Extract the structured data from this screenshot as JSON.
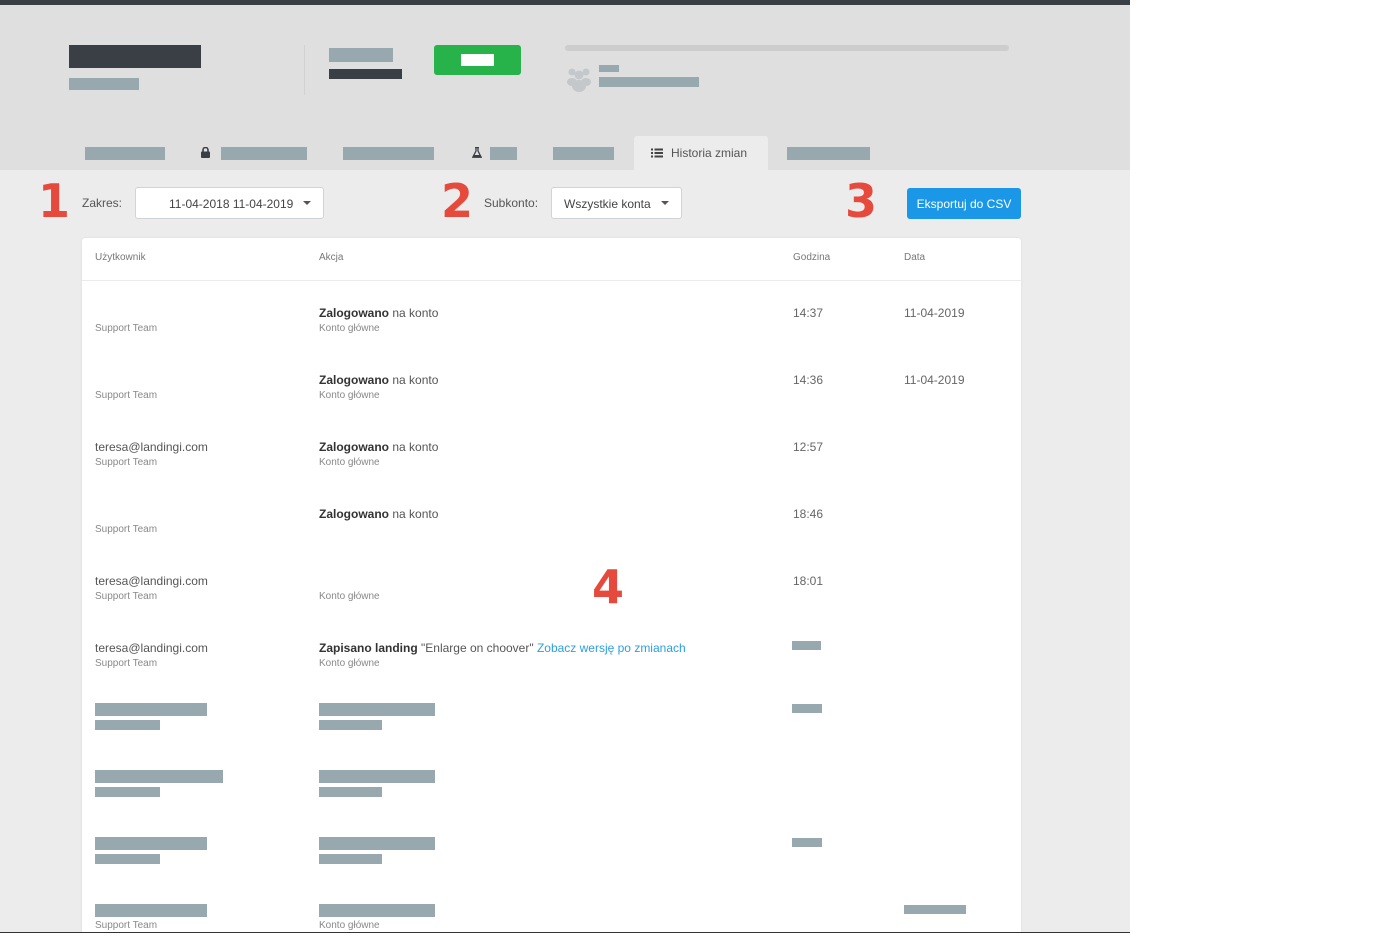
{
  "tabs": {
    "active_label": "Historia zmian"
  },
  "filters": {
    "range_label": "Zakres:",
    "range_value": "11-04-2018 11-04-2019",
    "subaccount_label": "Subkonto:",
    "subaccount_value": "Wszystkie konta",
    "export_label": "Eksportuj do CSV"
  },
  "annotations": [
    "1",
    "2",
    "3",
    "4"
  ],
  "table": {
    "headers": [
      "Użytkownik",
      "Akcja",
      "Godzina",
      "Data"
    ],
    "rows": [
      {
        "email": "",
        "team": "Support Team",
        "action_bold": "Zalogowano",
        "action_rest": " na konto",
        "sub": "Konto główne",
        "time": "14:37",
        "date": "11-04-2019"
      },
      {
        "email": "",
        "team": "Support Team",
        "action_bold": "Zalogowano",
        "action_rest": " na konto",
        "sub": "Konto główne",
        "time": "14:36",
        "date": "11-04-2019"
      },
      {
        "email": "teresa@landingi.com",
        "team": "Support Team",
        "action_bold": "Zalogowano",
        "action_rest": " na konto",
        "sub": "Konto główne",
        "time": "12:57",
        "date": ""
      },
      {
        "email": "",
        "team": "Support Team",
        "action_bold": "Zalogowano",
        "action_rest": " na konto",
        "sub": "",
        "time": "18:46",
        "date": ""
      },
      {
        "email": "teresa@landingi.com",
        "team": "Support Team",
        "action_bold": "",
        "action_rest": "",
        "sub": "Konto główne",
        "time": "18:01",
        "date": ""
      },
      {
        "email": "teresa@landingi.com",
        "team": "Support Team",
        "action_bold": "Zapisano landing",
        "action_rest": " \"Enlarge on choover\" ",
        "action_link": "Zobacz wersję po zmianach",
        "sub": "Konto główne",
        "time": "",
        "date": ""
      }
    ],
    "last_row": {
      "team": "Support Team",
      "sub": "Konto główne"
    }
  }
}
